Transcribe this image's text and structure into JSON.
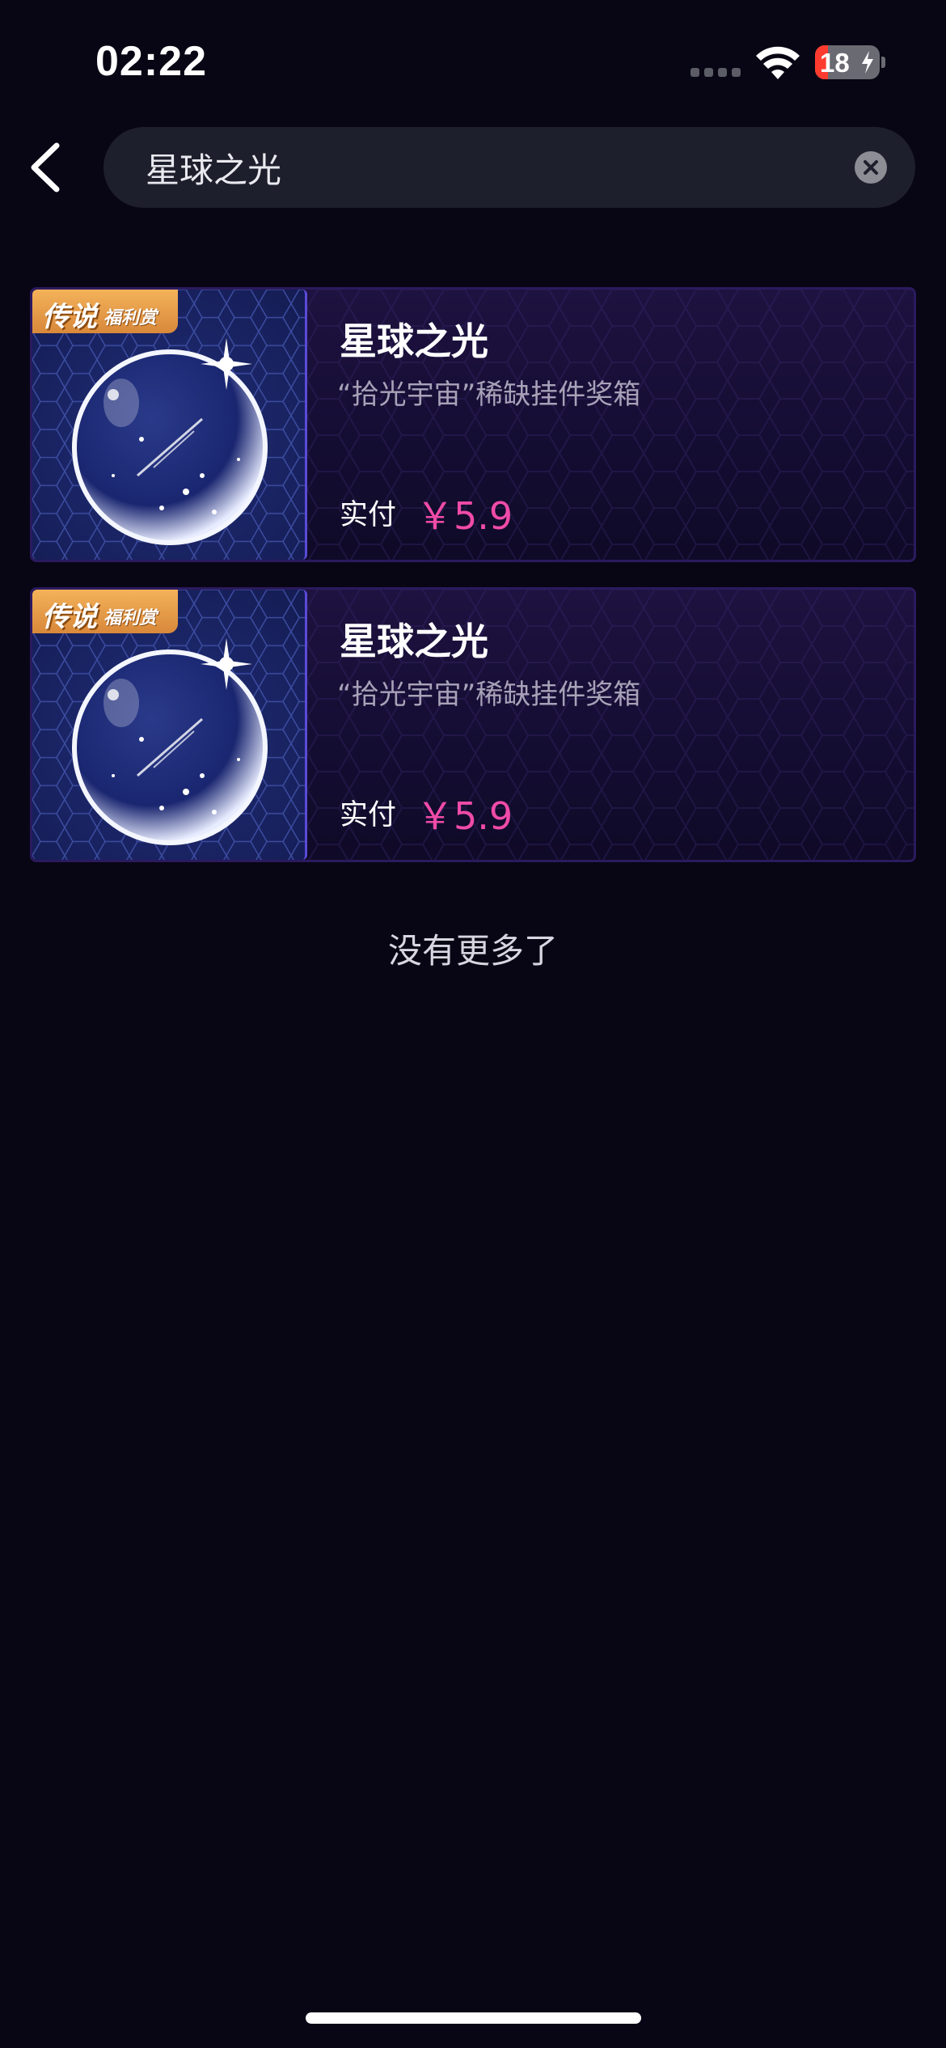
{
  "status_bar": {
    "time": "02:22",
    "battery_level": "18",
    "wifi_icon": "wifi-icon",
    "signal_icon": "cellular-signal-icon",
    "charging_icon": "bolt-icon"
  },
  "search": {
    "query": "星球之光",
    "back_icon": "chevron-left-icon",
    "clear_icon": "close-circle-icon"
  },
  "results": [
    {
      "badge_main": "传说",
      "badge_sub": "福利赏",
      "title": "星球之光",
      "subtitle": "“拾光宇宙”稀缺挂件奖箱",
      "price_label": "实付",
      "price": "￥5.9"
    },
    {
      "badge_main": "传说",
      "badge_sub": "福利赏",
      "title": "星球之光",
      "subtitle": "“拾光宇宙”稀缺挂件奖箱",
      "price_label": "实付",
      "price": "￥5.9"
    }
  ],
  "footer": {
    "no_more_text": "没有更多了"
  },
  "colors": {
    "background": "#080614",
    "price": "#f04ba8",
    "badge": "#e59a45",
    "card_border": "#2b1a5e"
  }
}
